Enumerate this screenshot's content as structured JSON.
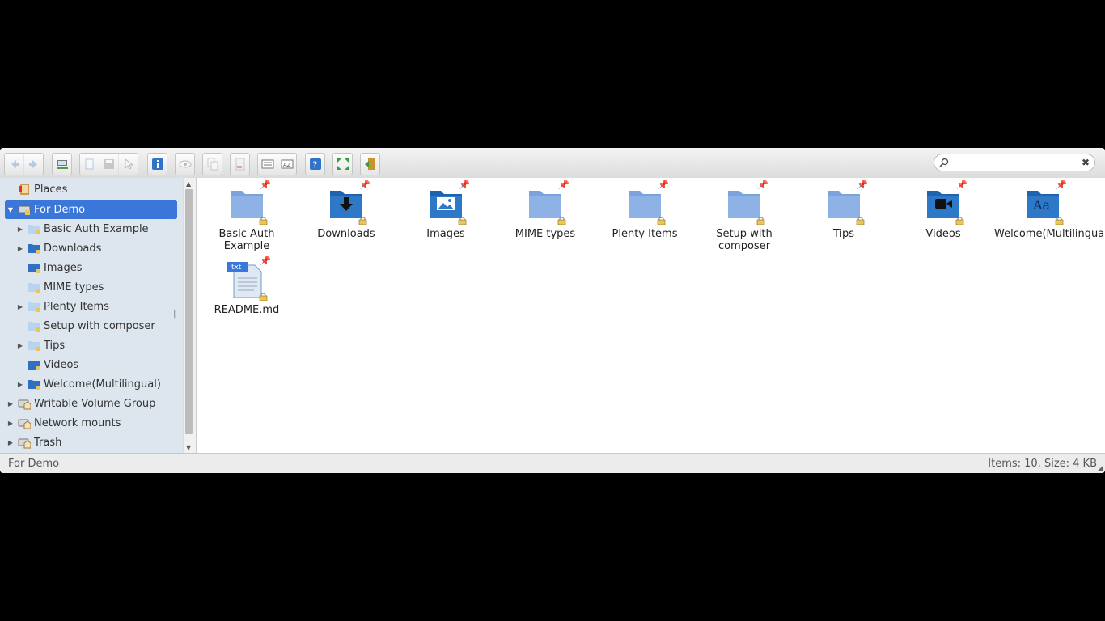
{
  "toolbar": {
    "buttons": [
      "back-icon",
      "forward-icon",
      "home-icon",
      "copy-icon",
      "save-icon",
      "select-icon",
      "info-icon",
      "eye-icon",
      "duplicate-icon",
      "delete-icon",
      "view-icon",
      "sort-icon",
      "help-icon",
      "fullscreen-icon",
      "exit-icon"
    ]
  },
  "search": {
    "value": "",
    "placeholder": ""
  },
  "tree": {
    "places": "Places",
    "root": "For Demo",
    "children": [
      "Basic Auth Example",
      "Downloads",
      "Images",
      "MIME types",
      "Plenty Items",
      "Setup with composer",
      "Tips",
      "Videos",
      "Welcome(Multilingual)"
    ],
    "others": [
      "Writable Volume Group",
      "Network mounts",
      "Trash"
    ]
  },
  "items": [
    {
      "name": "Basic Auth Example",
      "icon": "folder-icon"
    },
    {
      "name": "Downloads",
      "icon": "downloads-folder-icon"
    },
    {
      "name": "Images",
      "icon": "images-folder-icon"
    },
    {
      "name": "MIME types",
      "icon": "folder-icon"
    },
    {
      "name": "Plenty Items",
      "icon": "folder-icon"
    },
    {
      "name": "Setup with composer",
      "icon": "folder-icon"
    },
    {
      "name": "Tips",
      "icon": "folder-icon"
    },
    {
      "name": "Videos",
      "icon": "videos-folder-icon"
    },
    {
      "name": "Welcome(Multilingual)",
      "icon": "text-folder-icon"
    },
    {
      "name": "README.md",
      "icon": "txt-file-icon",
      "badge": "txt"
    }
  ],
  "status": {
    "path": "For Demo",
    "summary": "Items: 10, Size: 4 KB"
  },
  "colors": {
    "selection": "#3b77d8",
    "folder": "#5b8fd6",
    "tree_bg": "#dde6ef"
  }
}
